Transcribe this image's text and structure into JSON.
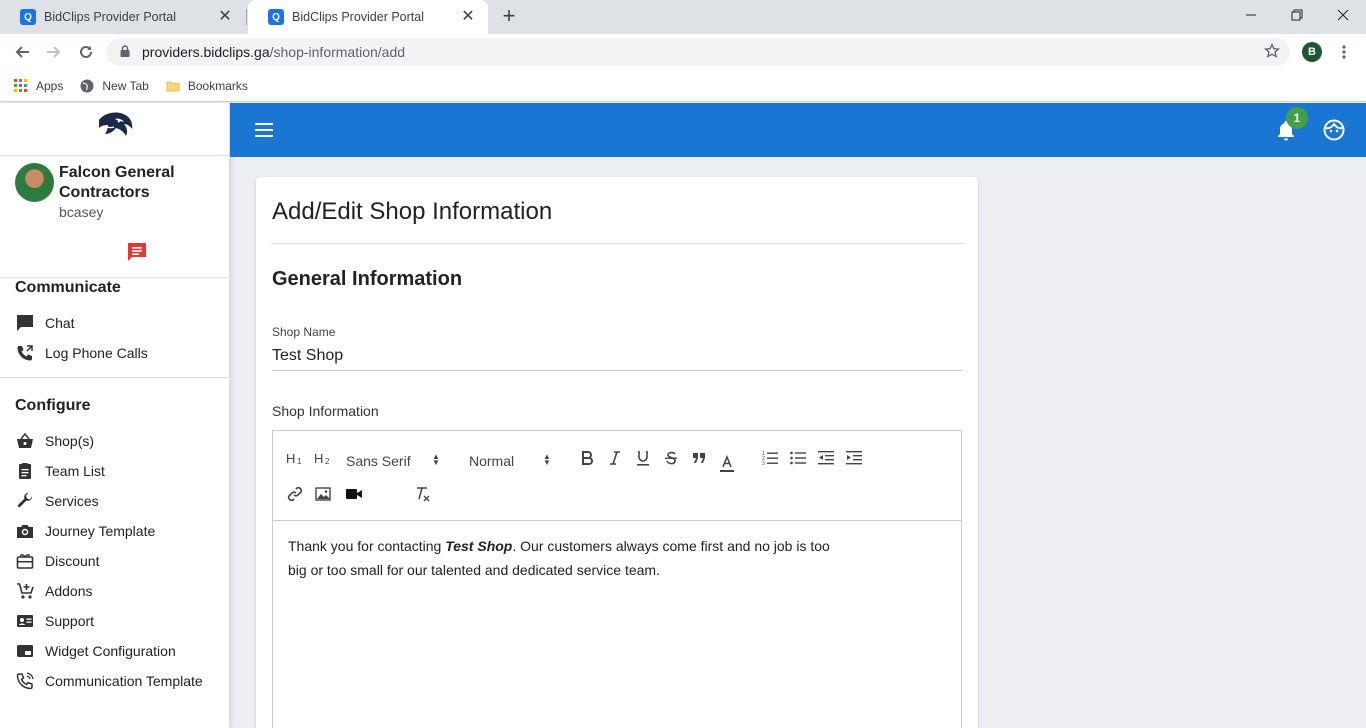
{
  "browser": {
    "tabs": [
      {
        "title": "BidClips Provider Portal",
        "favicon": "Q"
      },
      {
        "title": "BidClips Provider Portal",
        "favicon": "Q"
      }
    ],
    "url_host": "providers.bidclips.ga",
    "url_path": "/shop-information/add",
    "profile_initial": "B",
    "bookmarks": [
      {
        "label": "Apps",
        "icon": "apps-grid-icon"
      },
      {
        "label": "New Tab",
        "icon": "globe-icon"
      },
      {
        "label": "Bookmarks",
        "icon": "folder-icon"
      }
    ]
  },
  "sidebar": {
    "company": "Falcon General Contractors",
    "username": "bcasey",
    "sections": [
      {
        "title": "Communicate",
        "items": [
          {
            "label": "Chat",
            "icon": "chat-icon"
          },
          {
            "label": "Log Phone Calls",
            "icon": "phone-log-icon"
          }
        ]
      },
      {
        "title": "Configure",
        "items": [
          {
            "label": "Shop(s)",
            "icon": "basket-icon"
          },
          {
            "label": "Team List",
            "icon": "clipboard-icon"
          },
          {
            "label": "Services",
            "icon": "wrench-icon"
          },
          {
            "label": "Journey Template",
            "icon": "camera-icon"
          },
          {
            "label": "Discount",
            "icon": "gift-icon"
          },
          {
            "label": "Addons",
            "icon": "cart-add-icon"
          },
          {
            "label": "Support",
            "icon": "contact-card-icon"
          },
          {
            "label": "Widget Configuration",
            "icon": "widget-icon"
          },
          {
            "label": "Communication Template",
            "icon": "phone-icon"
          }
        ]
      }
    ]
  },
  "topbar": {
    "notification_count": "1",
    "colors": {
      "bar": "#1976d2",
      "badge": "#43a047"
    }
  },
  "main": {
    "page_title": "Add/Edit Shop Information",
    "section_title": "General Information",
    "shop_name_label": "Shop Name",
    "shop_name_value": "Test Shop",
    "shop_info_label": "Shop Information",
    "editor": {
      "font_select": "Sans Serif",
      "size_select": "Normal",
      "content_prefix": "Thank you for contacting ",
      "content_bold": "Test Shop",
      "content_suffix": ".  Our customers always come first and no job is too big or too small for our talented and dedicated service team."
    }
  }
}
